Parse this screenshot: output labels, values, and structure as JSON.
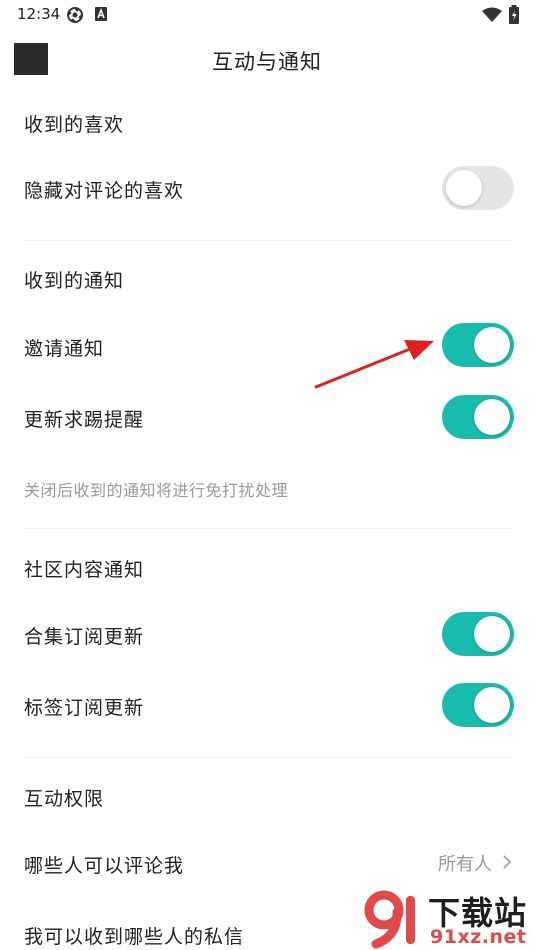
{
  "status_bar": {
    "time": "12:34",
    "icons": [
      "sync-icon",
      "a-badge-icon",
      "wifi-icon",
      "battery-charging-icon"
    ]
  },
  "header": {
    "title": "互动与通知"
  },
  "sections": {
    "likes": {
      "title": "收到的喜欢",
      "hide_comment_likes": {
        "label": "隐藏对评论的喜欢",
        "enabled": false
      }
    },
    "notifications": {
      "title": "收到的通知",
      "invite": {
        "label": "邀请通知",
        "enabled": true
      },
      "update_reminder": {
        "label": "更新求踢提醒",
        "enabled": true
      },
      "hint": "关闭后收到的通知将进行免打扰处理"
    },
    "community": {
      "title": "社区内容通知",
      "collection_updates": {
        "label": "合集订阅更新",
        "enabled": true
      },
      "tag_updates": {
        "label": "标签订阅更新",
        "enabled": true
      }
    },
    "permissions": {
      "title": "互动权限",
      "who_can_comment": {
        "label": "哪些人可以评论我",
        "value": "所有人"
      },
      "who_can_message": {
        "label": "我可以收到哪些人的私信"
      }
    }
  },
  "colors": {
    "toggle_on": "#17bcae",
    "toggle_off": "#e5e5e5",
    "annotation_arrow": "#e02020"
  },
  "watermark": {
    "text": "下载站",
    "domain": "91xz.net"
  }
}
